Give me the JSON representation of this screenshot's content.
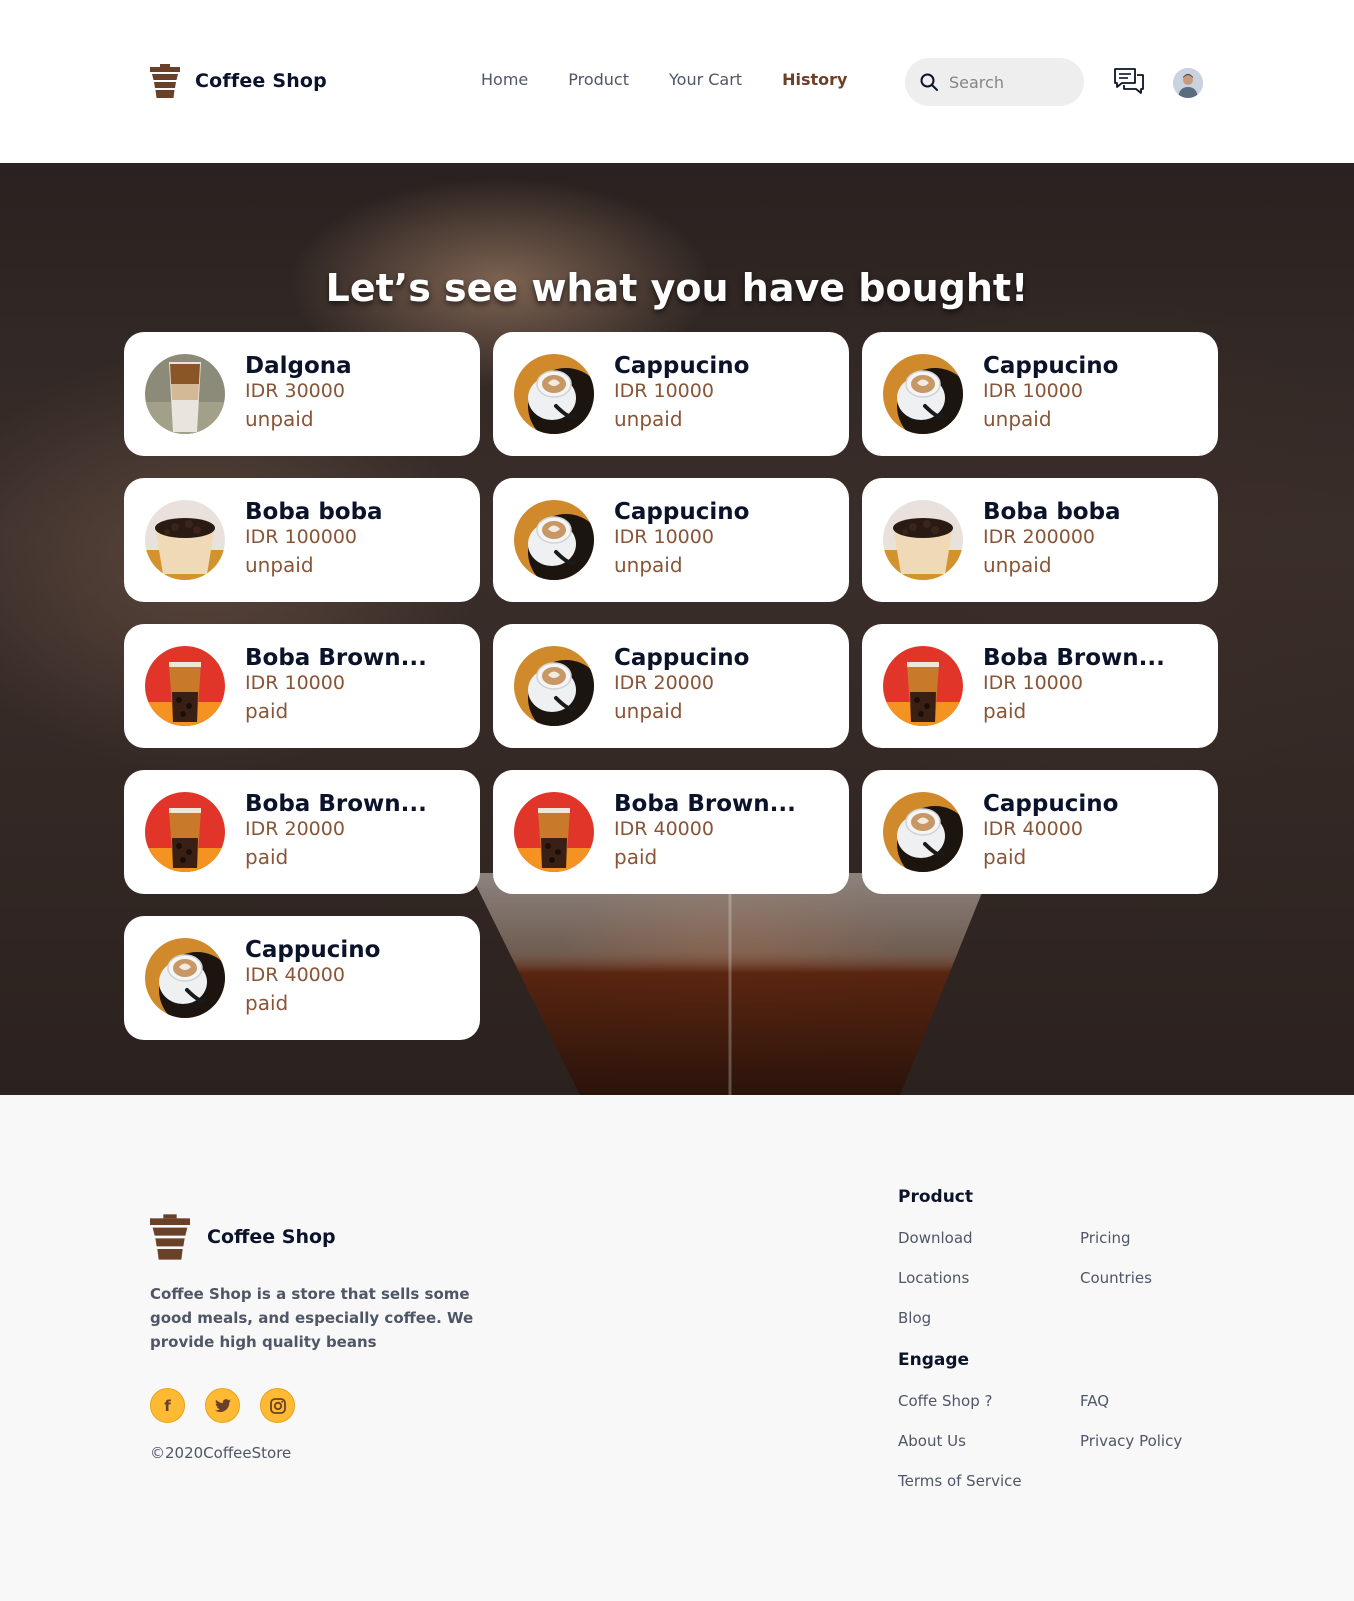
{
  "header": {
    "brand": "Coffee Shop",
    "nav": [
      "Home",
      "Product",
      "Your Cart",
      "History"
    ],
    "active_nav": "History",
    "search_placeholder": "Search"
  },
  "hero": {
    "title": "Let’s see what you have bought!"
  },
  "history": [
    {
      "name": "Dalgona",
      "price": "IDR 30000",
      "status": "unpaid",
      "image": "dalgona"
    },
    {
      "name": "Cappucino",
      "price": "IDR 10000",
      "status": "unpaid",
      "image": "cappucino"
    },
    {
      "name": "Cappucino",
      "price": "IDR 10000",
      "status": "unpaid",
      "image": "cappucino"
    },
    {
      "name": "Boba boba",
      "price": "IDR 100000",
      "status": "unpaid",
      "image": "boba"
    },
    {
      "name": "Cappucino",
      "price": "IDR 10000",
      "status": "unpaid",
      "image": "cappucino"
    },
    {
      "name": "Boba boba",
      "price": "IDR 200000",
      "status": "unpaid",
      "image": "boba"
    },
    {
      "name": "Boba Brown...",
      "price": "IDR 10000",
      "status": "paid",
      "image": "boba-brown"
    },
    {
      "name": "Cappucino",
      "price": "IDR 20000",
      "status": "unpaid",
      "image": "cappucino"
    },
    {
      "name": "Boba Brown...",
      "price": "IDR 10000",
      "status": "paid",
      "image": "boba-brown"
    },
    {
      "name": "Boba Brown...",
      "price": "IDR 20000",
      "status": "paid",
      "image": "boba-brown"
    },
    {
      "name": "Boba Brown...",
      "price": "IDR 40000",
      "status": "paid",
      "image": "boba-brown"
    },
    {
      "name": "Cappucino",
      "price": "IDR 40000",
      "status": "paid",
      "image": "cappucino"
    },
    {
      "name": "Cappucino",
      "price": "IDR 40000",
      "status": "paid",
      "image": "cappucino"
    }
  ],
  "footer": {
    "brand": "Coffee Shop",
    "description": "Coffee Shop is a store that sells some good meals, and especially coffee. We provide high quality beans",
    "socials": [
      "facebook-icon",
      "twitter-icon",
      "instagram-icon"
    ],
    "copyright": "©2020CoffeeStore",
    "product_title": "Product",
    "product_links": [
      "Download",
      "Pricing",
      "Locations",
      "Countries",
      "Blog"
    ],
    "engage_title": "Engage",
    "engage_links": [
      "Coffe Shop ?",
      "FAQ",
      "About Us",
      "Privacy Policy",
      "Terms of Service"
    ]
  },
  "colors": {
    "brand_brown": "#6a4029",
    "accent_yellow": "#ffba33",
    "price_brown": "#895537"
  }
}
